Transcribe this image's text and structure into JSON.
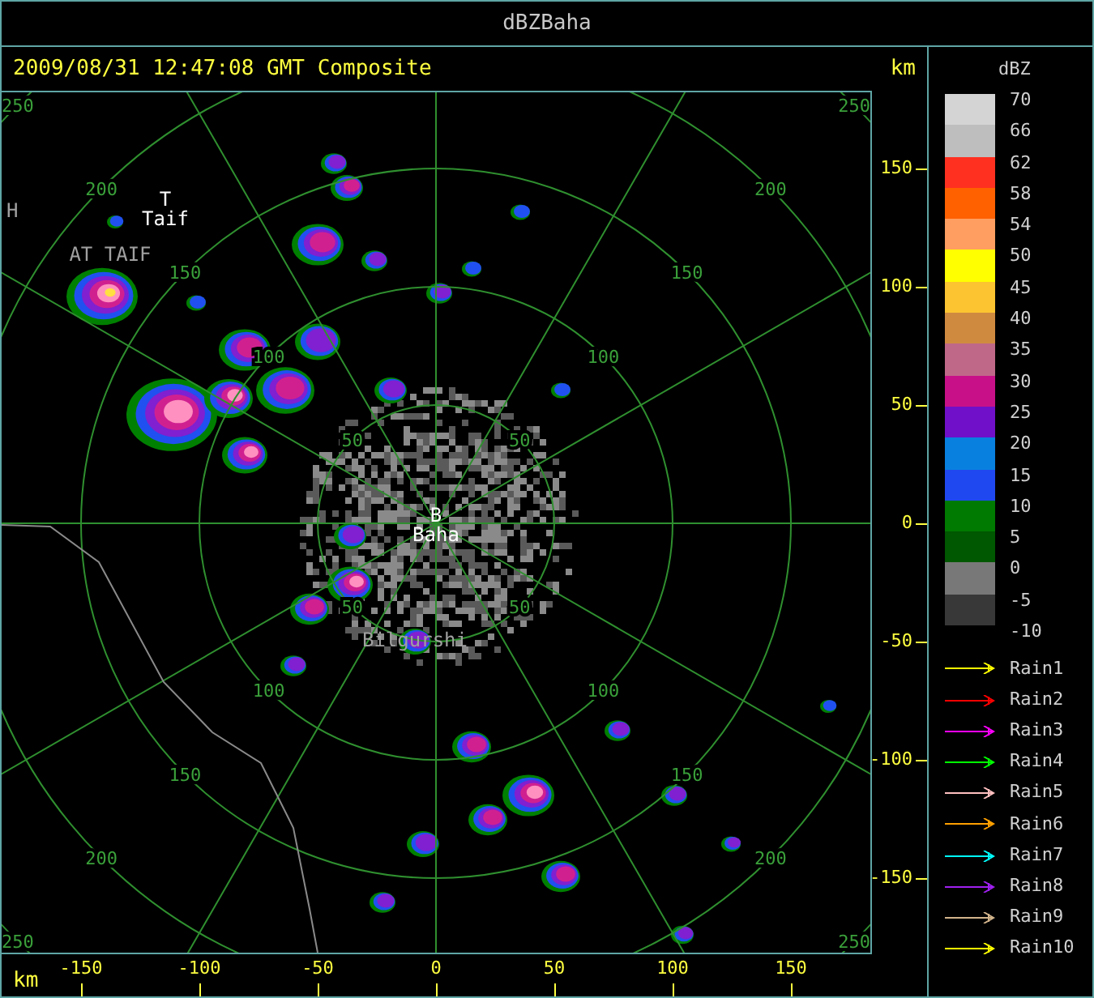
{
  "window": {
    "title": "dBZBaha"
  },
  "header": {
    "timestamp": "2009/08/31 12:47:08 GMT Composite",
    "unit": "km"
  },
  "map": {
    "range_rings": [
      {
        "labels": [
          "50",
          "50",
          "50",
          "50"
        ]
      },
      {
        "labels": [
          "100",
          "100",
          "100",
          "100"
        ]
      },
      {
        "labels": [
          "150",
          "150",
          "150",
          "150"
        ]
      },
      {
        "labels": [
          "200",
          "200",
          "200",
          "200"
        ]
      },
      {
        "labels": [
          "250",
          "250",
          "250",
          "250"
        ]
      }
    ],
    "places": [
      {
        "kind": "station",
        "symbol": "T",
        "name": "Taif"
      },
      {
        "kind": "town",
        "name": "AT TAIF"
      },
      {
        "kind": "town",
        "name": "H"
      },
      {
        "kind": "station",
        "symbol": "B",
        "name": "Baha"
      },
      {
        "kind": "town",
        "name": "Bilgurshi"
      }
    ]
  },
  "y_axis": {
    "ticks": [
      "150",
      "100",
      "50",
      "0",
      "-50",
      "-100",
      "-150"
    ]
  },
  "x_axis": {
    "unit": "km",
    "ticks": [
      "-150",
      "-100",
      "-50",
      "0",
      "50",
      "100",
      "150"
    ]
  },
  "legend": {
    "title": "dBZ",
    "swatches": [
      {
        "color": "#d4d4d4"
      },
      {
        "color": "#bebebe"
      },
      {
        "color": "#ff3020"
      },
      {
        "color": "#ff6000"
      },
      {
        "color": "#ff9e60"
      },
      {
        "color": "#ffff00"
      },
      {
        "color": "#fcc430"
      },
      {
        "color": "#d08a40"
      },
      {
        "color": "#c06888"
      },
      {
        "color": "#c81088"
      },
      {
        "color": "#7010c8"
      },
      {
        "color": "#0880e0"
      },
      {
        "color": "#2048f0"
      },
      {
        "color": "#007a00"
      },
      {
        "color": "#005800"
      },
      {
        "color": "#787878"
      },
      {
        "color": "#383838"
      }
    ],
    "labels": [
      "70",
      "66",
      "62",
      "58",
      "54",
      "50",
      "45",
      "40",
      "35",
      "30",
      "25",
      "20",
      "15",
      "10",
      "5",
      "0",
      "-5",
      "-10"
    ]
  },
  "tracks": [
    {
      "name": "Rain1",
      "color": "#ffff00"
    },
    {
      "name": "Rain2",
      "color": "#ff0000"
    },
    {
      "name": "Rain3",
      "color": "#ff00ff"
    },
    {
      "name": "Rain4",
      "color": "#00ff00"
    },
    {
      "name": "Rain5",
      "color": "#ffc0c0"
    },
    {
      "name": "Rain6",
      "color": "#ffa000"
    },
    {
      "name": "Rain7",
      "color": "#00ffff"
    },
    {
      "name": "Rain8",
      "color": "#a020f0"
    },
    {
      "name": "Rain9",
      "color": "#d2b48c"
    },
    {
      "name": "Rain10",
      "color": "#ffff00"
    }
  ]
}
